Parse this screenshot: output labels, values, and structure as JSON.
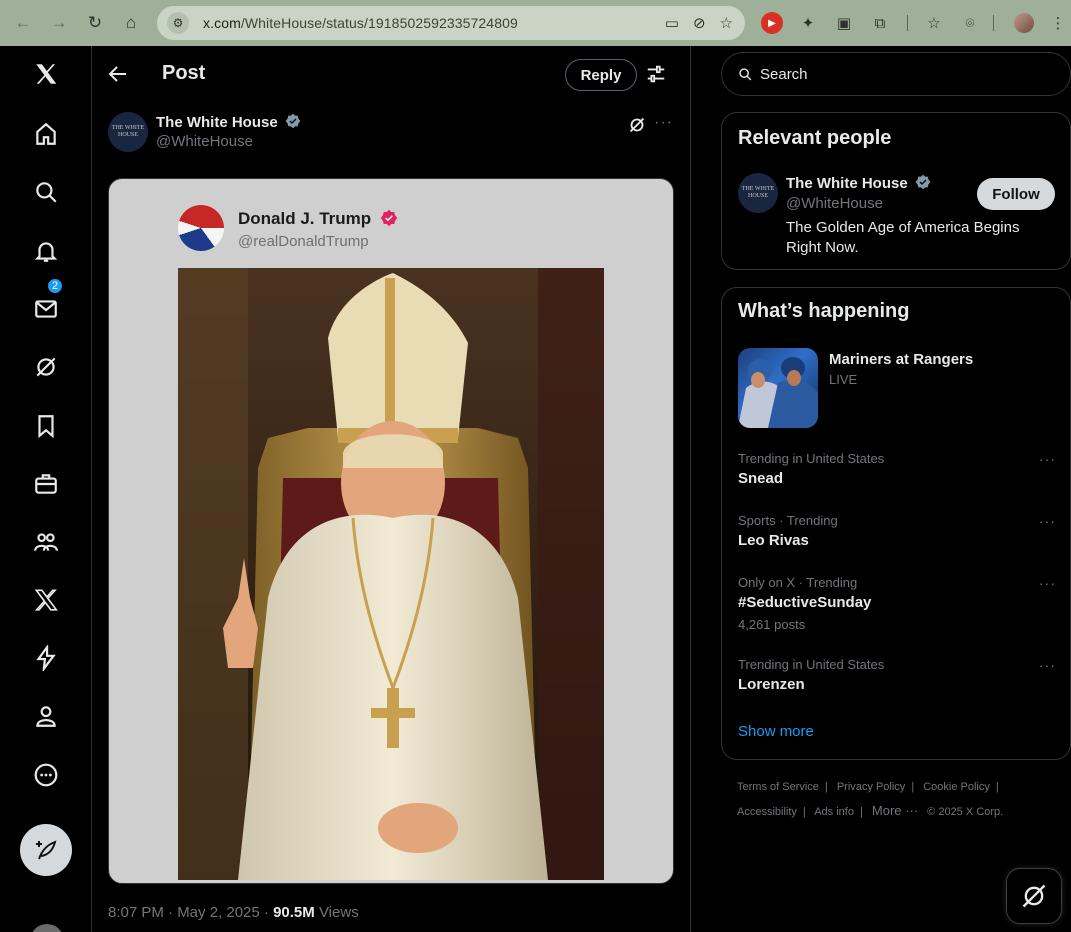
{
  "browser": {
    "url_host": "x.com",
    "url_path": "/WhiteHouse/status/1918502592335724809",
    "ext_badge": "▶"
  },
  "nav": {
    "notification_count": "2"
  },
  "header": {
    "title": "Post",
    "reply_label": "Reply"
  },
  "post": {
    "author_name": "The White House",
    "author_handle": "@WhiteHouse",
    "avatar_text": "THE WHITE HOUSE",
    "quoted_name": "Donald J. Trump",
    "quoted_handle": "@realDonaldTrump",
    "time": "8:07 PM · May 2, 2025 · ",
    "views_count": "90.5M",
    "views_label": " Views"
  },
  "search": {
    "placeholder": "Search"
  },
  "relevant_people": {
    "title": "Relevant people",
    "name": "The White House",
    "handle": "@WhiteHouse",
    "bio": "The Golden Age of America Begins Right Now.",
    "follow_label": "Follow"
  },
  "happening": {
    "title": "What’s happening",
    "event_title": "Mariners at Rangers",
    "event_status": "LIVE",
    "trends": [
      {
        "context": "Trending in United States",
        "name": "Snead",
        "count": ""
      },
      {
        "context": "Sports · Trending",
        "name": "Leo Rivas",
        "count": ""
      },
      {
        "context": "Only on X · Trending",
        "name": "#SeductiveSunday",
        "count": "4,261 posts"
      },
      {
        "context": "Trending in United States",
        "name": "Lorenzen",
        "count": ""
      }
    ],
    "show_more": "Show more"
  },
  "footer": {
    "terms": "Terms of Service",
    "privacy": "Privacy Policy",
    "cookie": "Cookie Policy",
    "accessibility": "Accessibility",
    "ads": "Ads info",
    "more": "More ···",
    "copyright": "© 2025 X Corp."
  },
  "colors": {
    "accent": "#1d9bf0",
    "background": "#000000",
    "chrome": "#9fb09a"
  }
}
